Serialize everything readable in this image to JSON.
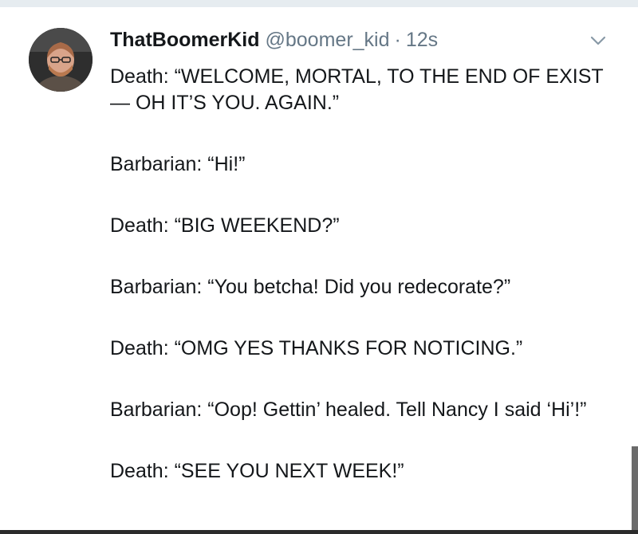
{
  "tweet": {
    "display_name": "ThatBoomerKid",
    "handle": "@boomer_kid",
    "separator": "·",
    "time": "12s",
    "icons": {
      "avatar": "profile-photo",
      "menu": "chevron-down-icon"
    },
    "lines": [
      "Death: “WELCOME, MORTAL, TO THE END OF EXIST— OH IT’S YOU. AGAIN.”",
      "Barbarian: “Hi!”",
      "Death: “BIG WEEKEND?”",
      "Barbarian: “You betcha! Did you redecorate?”",
      "Death: “OMG YES THANKS FOR NOTICING.”",
      "Barbarian: “Oop! Gettin’ healed. Tell Nancy I said ‘Hi’!”",
      "Death: “SEE YOU NEXT WEEK!”"
    ]
  },
  "colors": {
    "text": "#14171a",
    "secondary": "#657786",
    "top_strip": "#e6ecf0"
  }
}
